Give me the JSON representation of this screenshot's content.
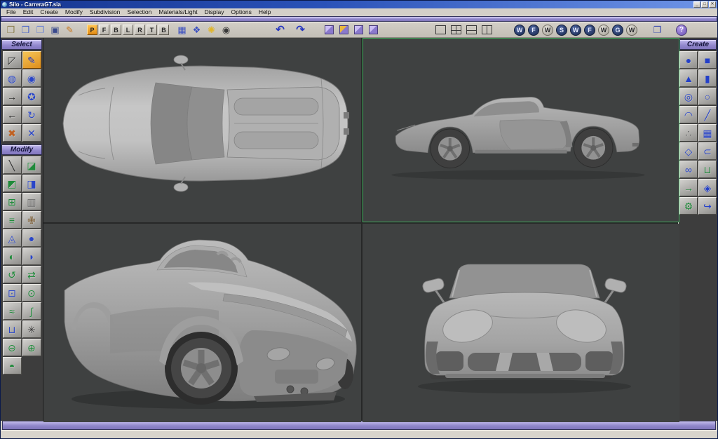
{
  "colors": {
    "titlebar_blue": "#2a52b8",
    "chrome_gray": "#d4d0c8",
    "accent_purple": "#9087ca",
    "viewport_background": "#3f4141",
    "active_viewport_border": "#3fae5c",
    "active_tool_orange": "#e89c2e"
  },
  "window": {
    "title": "Silo - CarreraGT.sia",
    "buttons": [
      {
        "name": "minimize-button",
        "glyph": "_"
      },
      {
        "name": "maximize-button",
        "glyph": "□"
      },
      {
        "name": "close-button",
        "glyph": "✕"
      }
    ]
  },
  "menubar": {
    "items": [
      {
        "name": "menu-file",
        "label": "File"
      },
      {
        "name": "menu-edit",
        "label": "Edit"
      },
      {
        "name": "menu-create",
        "label": "Create"
      },
      {
        "name": "menu-modify",
        "label": "Modify"
      },
      {
        "name": "menu-subdivision",
        "label": "Subdivision"
      },
      {
        "name": "menu-selection",
        "label": "Selection"
      },
      {
        "name": "menu-materials-light",
        "label": "Materials/Light"
      },
      {
        "name": "menu-display",
        "label": "Display"
      },
      {
        "name": "menu-options",
        "label": "Options"
      },
      {
        "name": "menu-help",
        "label": "Help"
      }
    ]
  },
  "toolbar": {
    "file_group": [
      {
        "name": "new-scene-button",
        "glyph": "❒",
        "color": "#8c8050"
      },
      {
        "name": "open-file-button",
        "glyph": "❒",
        "color": "#4a66c8"
      },
      {
        "name": "save-scene-as-button",
        "glyph": "❐",
        "color": "#6b84d4"
      },
      {
        "name": "save-button",
        "glyph": "▣",
        "color": "#3a4a8c"
      },
      {
        "name": "export-button",
        "glyph": "✎",
        "color": "#c87820"
      }
    ],
    "view_letter_buttons": [
      {
        "name": "view-perspective-button",
        "label": "P",
        "active": true
      },
      {
        "name": "view-front-button",
        "label": "F"
      },
      {
        "name": "view-back-button",
        "label": "B"
      },
      {
        "name": "view-left-button",
        "label": "L"
      },
      {
        "name": "view-right-button",
        "label": "R"
      },
      {
        "name": "view-top-button",
        "label": "T"
      },
      {
        "name": "view-bottom-button",
        "label": "B"
      }
    ],
    "display_group": [
      {
        "name": "grid-toggle-button",
        "glyph": "▦",
        "color": "#3c50c0"
      },
      {
        "name": "lattice-toggle-button",
        "glyph": "❖",
        "color": "#3c50c0"
      },
      {
        "name": "lights-toggle-button",
        "glyph": "✺",
        "color": "#e0b52a"
      },
      {
        "name": "camera-button",
        "glyph": "◉",
        "color": "#3a3a3a"
      }
    ],
    "undo_redo": [
      {
        "name": "undo-button",
        "glyph": "↶",
        "color": "#2838c0"
      },
      {
        "name": "redo-button",
        "glyph": "↷",
        "color": "#2838c0"
      }
    ],
    "subdivision_cubes": [
      {
        "name": "subdivide-button",
        "variant": "purple"
      },
      {
        "name": "unsubdivide-button",
        "variant": "orange-face"
      },
      {
        "name": "crease-button",
        "variant": "purple"
      },
      {
        "name": "uncrease-button",
        "variant": "purple"
      }
    ],
    "layout_buttons": [
      {
        "name": "layout-single-button",
        "variant": "single"
      },
      {
        "name": "layout-quad-button",
        "variant": "quad"
      },
      {
        "name": "layout-hsplit-button",
        "variant": "hsplit"
      },
      {
        "name": "layout-vsplit-button",
        "variant": "vsplit"
      }
    ],
    "shade_toggle_buttons": [
      {
        "name": "wireframe-toggle-1",
        "label": "W",
        "variant": "dark"
      },
      {
        "name": "flat-shade-toggle-1",
        "label": "F",
        "variant": "dark"
      },
      {
        "name": "wireframe-toggle-2",
        "label": "W",
        "variant": "light"
      },
      {
        "name": "smooth-shade-toggle",
        "label": "S",
        "variant": "dark"
      },
      {
        "name": "wireframe-toggle-3",
        "label": "W",
        "variant": "dark"
      },
      {
        "name": "flat-shade-toggle-2",
        "label": "F",
        "variant": "dark"
      },
      {
        "name": "wireframe-toggle-4",
        "label": "W",
        "variant": "light"
      },
      {
        "name": "ghost-shade-toggle",
        "label": "G",
        "variant": "dark"
      },
      {
        "name": "wireframe-toggle-5",
        "label": "W",
        "variant": "light"
      }
    ],
    "manual_button": {
      "name": "manual-button",
      "glyph": "❐",
      "color": "#3448b0"
    },
    "help_button": {
      "name": "help-button",
      "label": "?"
    }
  },
  "sidebar_left": {
    "select_header": "Select",
    "select_items": [
      {
        "name": "area-select-tool-button",
        "glyph": "◸",
        "color": "#2a2a2a"
      },
      {
        "name": "paint-select-tool-button",
        "glyph": "✎",
        "color": "#1d2fb0",
        "active": true
      },
      {
        "name": "select-loop-tool-button",
        "glyph": "◍",
        "color": "#2a46c8"
      },
      {
        "name": "select-ring-tool-button",
        "glyph": "◉",
        "color": "#2a46c8"
      },
      {
        "name": "grow-selection-tool-button",
        "glyph": "→",
        "color": "#222222"
      },
      {
        "name": "select-all-loops-tool-button",
        "glyph": "✪",
        "color": "#2a46c8"
      },
      {
        "name": "shrink-selection-tool-button",
        "glyph": "←",
        "color": "#222222"
      },
      {
        "name": "invert-selection-tool-button",
        "glyph": "↻",
        "color": "#2a46c8"
      },
      {
        "name": "mirror-selection-tool-button",
        "glyph": "✖",
        "color": "#c06020"
      },
      {
        "name": "symmetry-selection-tool-button",
        "glyph": "✕",
        "color": "#2a46c8"
      }
    ],
    "modify_header": "Modify",
    "modify_items": [
      {
        "name": "knife-tool-button",
        "glyph": "╲",
        "color": "#2a2a2a"
      },
      {
        "name": "cut-tool-button",
        "glyph": "◪",
        "color": "#1f8a3a"
      },
      {
        "name": "extrude-tool-button",
        "glyph": "◩",
        "color": "#1f8a3a"
      },
      {
        "name": "bevel-tool-button",
        "glyph": "◨",
        "color": "#2a46c8"
      },
      {
        "name": "inset-tool-button",
        "glyph": "⊞",
        "color": "#1f8a3a"
      },
      {
        "name": "bridge-tool-button",
        "glyph": "▥",
        "color": "#6a6a6a"
      },
      {
        "name": "shift-loop-tool-button",
        "glyph": "≡",
        "color": "#1f8a3a"
      },
      {
        "name": "tweak-tool-button",
        "glyph": "✙",
        "color": "#7a5a30"
      },
      {
        "name": "split-tool-button",
        "glyph": "◬",
        "color": "#2a46c8"
      },
      {
        "name": "round-tool-button",
        "glyph": "●",
        "color": "#2a46c8"
      },
      {
        "name": "fill-hole-tool-button",
        "glyph": "◐",
        "color": "#1f8a3a"
      },
      {
        "name": "scoop-tool-button",
        "glyph": "◗",
        "color": "#2a46c8"
      },
      {
        "name": "spin-edge-tool-button",
        "glyph": "↺",
        "color": "#1f8a3a"
      },
      {
        "name": "flip-normals-tool-button",
        "glyph": "⇄",
        "color": "#1f8a3a"
      },
      {
        "name": "boolean-tool-button",
        "glyph": "⊡",
        "color": "#2a46c8"
      },
      {
        "name": "pin-tool-button",
        "glyph": "⊙",
        "color": "#1f8a3a"
      },
      {
        "name": "bend-tool-button",
        "glyph": "≈",
        "color": "#1f8a3a"
      },
      {
        "name": "twist-tool-button",
        "glyph": "∫",
        "color": "#1f8a3a"
      },
      {
        "name": "lathe-tool-button",
        "glyph": "⊔",
        "color": "#2a46c8"
      },
      {
        "name": "sculpt-brush-tool-button",
        "glyph": "✳",
        "color": "#3a3a3a"
      },
      {
        "name": "unsubdivide-shield-tool-button",
        "glyph": "⊖",
        "color": "#1f8a3a"
      },
      {
        "name": "subdivide-shield-tool-button",
        "glyph": "⊕",
        "color": "#1f8a3a"
      },
      {
        "name": "smooth-tool-button",
        "glyph": "◓",
        "color": "#1f8a3a"
      }
    ]
  },
  "sidebar_right": {
    "create_header": "Create",
    "create_items": [
      {
        "name": "create-sphere-button",
        "glyph": "●",
        "color": "#2440c8"
      },
      {
        "name": "create-cube-button",
        "glyph": "■",
        "color": "#2440c8"
      },
      {
        "name": "create-cone-button",
        "glyph": "▲",
        "color": "#2440c8"
      },
      {
        "name": "create-cylinder-button",
        "glyph": "▮",
        "color": "#2440c8"
      },
      {
        "name": "create-torus-button",
        "glyph": "◎",
        "color": "#2440c8"
      },
      {
        "name": "create-circle-button",
        "glyph": "○",
        "color": "#2440c8"
      },
      {
        "name": "create-arc-button",
        "glyph": "◠",
        "color": "#2440c8"
      },
      {
        "name": "create-line-button",
        "glyph": "╱",
        "color": "#2440c8"
      },
      {
        "name": "create-lathe-object-button",
        "glyph": "∴",
        "color": "#5a5a5a"
      },
      {
        "name": "create-grid-plane-button",
        "glyph": "▦",
        "color": "#2440c8"
      },
      {
        "name": "create-polygon-button",
        "glyph": "◇",
        "color": "#2440c8"
      },
      {
        "name": "create-curve-button",
        "glyph": "⊂",
        "color": "#2440c8"
      },
      {
        "name": "create-edge-button",
        "glyph": "∞",
        "color": "#2440c8"
      },
      {
        "name": "create-tube-button",
        "glyph": "⊔",
        "color": "#1f8a3a"
      },
      {
        "name": "duplicate-button",
        "glyph": "→",
        "color": "#1f8a3a"
      },
      {
        "name": "instance-mirror-button",
        "glyph": "◈",
        "color": "#2440c8"
      },
      {
        "name": "create-gear-button",
        "glyph": "⚙",
        "color": "#1f8a3a"
      },
      {
        "name": "sweep-button",
        "glyph": "↪",
        "color": "#2440c8"
      }
    ]
  },
  "viewports": {
    "layout": "quad",
    "active_pane": "top-right-side-view",
    "panes": [
      {
        "name": "viewport-top-view"
      },
      {
        "name": "viewport-side-view"
      },
      {
        "name": "viewport-perspective-view"
      },
      {
        "name": "viewport-front-view"
      }
    ],
    "model": "Porsche Carrera GT polygon model"
  },
  "statusbar": {
    "text": ""
  }
}
